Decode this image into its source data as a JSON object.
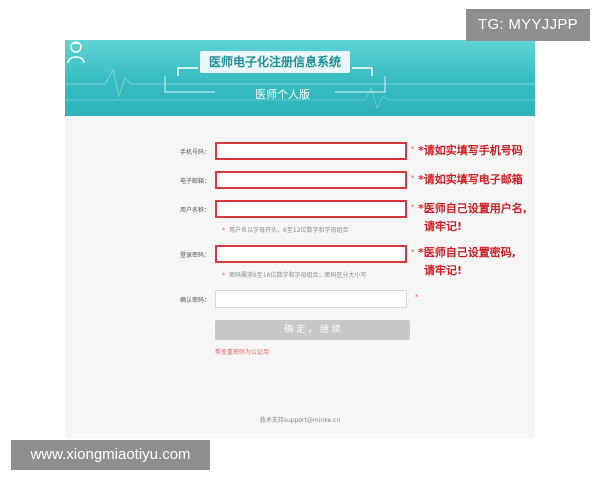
{
  "banner": {
    "title": "医师电子化注册信息系统",
    "subtitle": "医师个人版",
    "icon": "doctor-icon"
  },
  "form": {
    "fields": [
      {
        "label": "手机号码：",
        "value": "",
        "annotation": "请如实填写手机号码"
      },
      {
        "label": "电子邮箱：",
        "value": "",
        "annotation": "请如实填写电子邮箱"
      },
      {
        "label": "用户名称：",
        "value": "",
        "annotation_lines": [
          "医师自己设置用户名,",
          "请牢记!"
        ],
        "hint": "用户名以字母开头，6至12位数字和字母组合"
      },
      {
        "label": "登录密码：",
        "value": "",
        "annotation_lines": [
          "医师自己设置密码,",
          "请牢记!"
        ],
        "hint": "密码需求6至16位数字和字母组合，密码区分大小写"
      },
      {
        "label": "确认密码：",
        "value": ""
      }
    ],
    "required_mark": "*",
    "submit_label": "确 定 ， 继 续",
    "link_note": "帮查重密码为公证用"
  },
  "footer": {
    "support": "技术支持support@minke.cn"
  },
  "watermarks": {
    "tg": "TG: MYYJJPP",
    "site": "www.xiongmiaotiyu.com"
  },
  "colors": {
    "banner": "#36bcc2",
    "error_border": "#d9363e",
    "annotation": "#d21f27",
    "button": "#c8c8c8"
  }
}
